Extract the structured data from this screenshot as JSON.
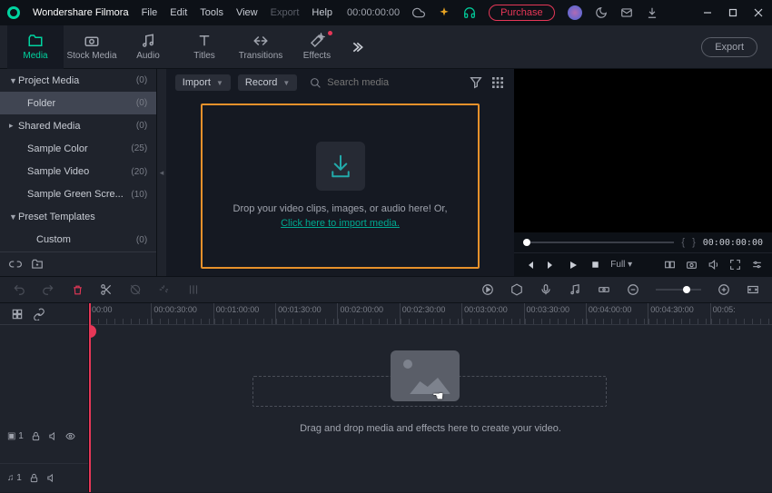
{
  "titlebar": {
    "app_name": "Wondershare Filmora",
    "menus": [
      "File",
      "Edit",
      "Tools",
      "View",
      "Export",
      "Help"
    ],
    "timecode": "00:00:00:00",
    "purchase_label": "Purchase"
  },
  "toolbar": {
    "tabs": [
      {
        "label": "Media"
      },
      {
        "label": "Stock Media"
      },
      {
        "label": "Audio"
      },
      {
        "label": "Titles"
      },
      {
        "label": "Transitions"
      },
      {
        "label": "Effects"
      }
    ],
    "export_label": "Export"
  },
  "sidebar": {
    "items": [
      {
        "label": "Project Media",
        "count": "(0)",
        "arrow": "▼"
      },
      {
        "label": "Folder",
        "count": "(0)"
      },
      {
        "label": "Shared Media",
        "count": "(0)",
        "arrow": "▸"
      },
      {
        "label": "Sample Color",
        "count": "(25)"
      },
      {
        "label": "Sample Video",
        "count": "(20)"
      },
      {
        "label": "Sample Green Scre...",
        "count": "(10)"
      },
      {
        "label": "Preset Templates",
        "count": "",
        "arrow": "▼"
      },
      {
        "label": "Custom",
        "count": "(0)"
      }
    ]
  },
  "media_area": {
    "import_label": "Import",
    "record_label": "Record",
    "search_placeholder": "Search media",
    "drop_line1": "Drop your video clips, images, or audio here! Or,",
    "drop_link": "Click here to import media."
  },
  "preview": {
    "timecode": "00:00:00:00",
    "quality_label": "Full"
  },
  "timeline": {
    "ruler": [
      "00:00",
      "00:00:30:00",
      "00:01:00:00",
      "00:01:30:00",
      "00:02:00:00",
      "00:02:30:00",
      "00:03:00:00",
      "00:03:30:00",
      "00:04:00:00",
      "00:04:30:00",
      "00:05:"
    ],
    "track_video_label": "▣ 1",
    "track_audio_label": "♫ 1",
    "hint": "Drag and drop media and effects here to create your video."
  }
}
